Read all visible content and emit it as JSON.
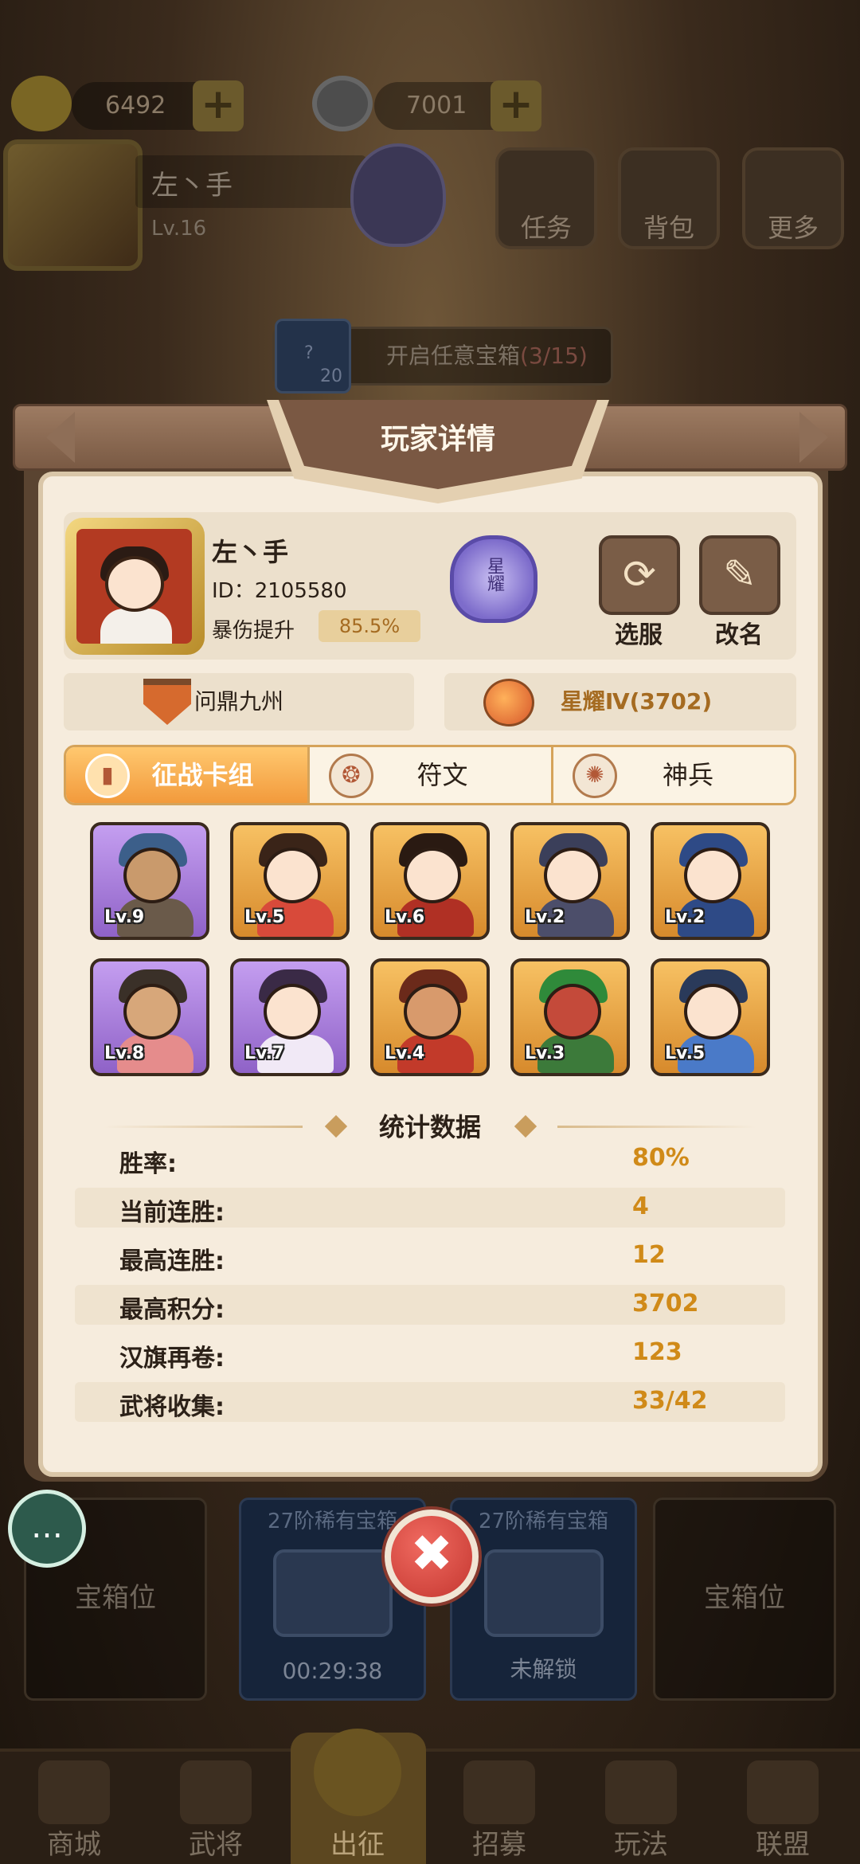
{
  "resources": {
    "gold": "6492",
    "coins": "7001"
  },
  "background_player": {
    "name": "左丶手",
    "level": "Lv.16",
    "badge": "星耀"
  },
  "top_menu": [
    {
      "label": "任务"
    },
    {
      "label": "背包"
    },
    {
      "label": "更多"
    }
  ],
  "chest_task": {
    "text": "开启任意宝箱",
    "progress": "(3/15)",
    "count": "20",
    "icon_mark": "?"
  },
  "chest_slots": [
    {
      "label": "宝箱位"
    },
    {
      "title": "27阶稀有宝箱",
      "time": "00:29:38"
    },
    {
      "title": "27阶稀有宝箱",
      "time": "未解锁"
    },
    {
      "label": "宝箱位"
    }
  ],
  "bottom_nav": [
    {
      "label": "商城"
    },
    {
      "label": "武将"
    },
    {
      "label": "出征"
    },
    {
      "label": "招募"
    },
    {
      "label": "玩法"
    },
    {
      "label": "联盟"
    }
  ],
  "modal": {
    "title": "玩家详情",
    "player": {
      "name": "左丶手",
      "id_text": "ID：2105580",
      "crit_label": "暴伤提升",
      "crit_value": "85.5%",
      "badge_text": "星耀"
    },
    "buttons": {
      "server": "选服",
      "rename": "改名"
    },
    "guild": "问鼎九州",
    "rank": "星耀Ⅳ(3702)",
    "tabs": [
      {
        "label": "征战卡组",
        "active": true
      },
      {
        "label": "符文",
        "active": false
      },
      {
        "label": "神兵",
        "active": false
      }
    ],
    "heroes": [
      {
        "level": "Lv.9",
        "rarity": "purple"
      },
      {
        "level": "Lv.5",
        "rarity": "orange"
      },
      {
        "level": "Lv.6",
        "rarity": "orange"
      },
      {
        "level": "Lv.2",
        "rarity": "orange"
      },
      {
        "level": "Lv.2",
        "rarity": "orange"
      },
      {
        "level": "Lv.8",
        "rarity": "purple"
      },
      {
        "level": "Lv.7",
        "rarity": "purple"
      },
      {
        "level": "Lv.4",
        "rarity": "orange"
      },
      {
        "level": "Lv.3",
        "rarity": "orange"
      },
      {
        "level": "Lv.5",
        "rarity": "orange"
      }
    ],
    "stats_title": "统计数据",
    "stats": [
      {
        "label": "胜率:",
        "value": "80%"
      },
      {
        "label": "当前连胜:",
        "value": "4"
      },
      {
        "label": "最高连胜:",
        "value": "12"
      },
      {
        "label": "最高积分:",
        "value": "3702"
      },
      {
        "label": "汉旗再卷:",
        "value": "123"
      },
      {
        "label": "武将收集:",
        "value": "33/42"
      }
    ],
    "close_symbol": "✖"
  },
  "icons": {
    "refresh": "⟳",
    "edit": "✎",
    "chat": "…"
  },
  "colors": {
    "accent_orange": "#f29a3c",
    "stat_value": "#d08a18",
    "purple_rarity": "#8f62c7",
    "orange_rarity": "#d78a2c"
  }
}
